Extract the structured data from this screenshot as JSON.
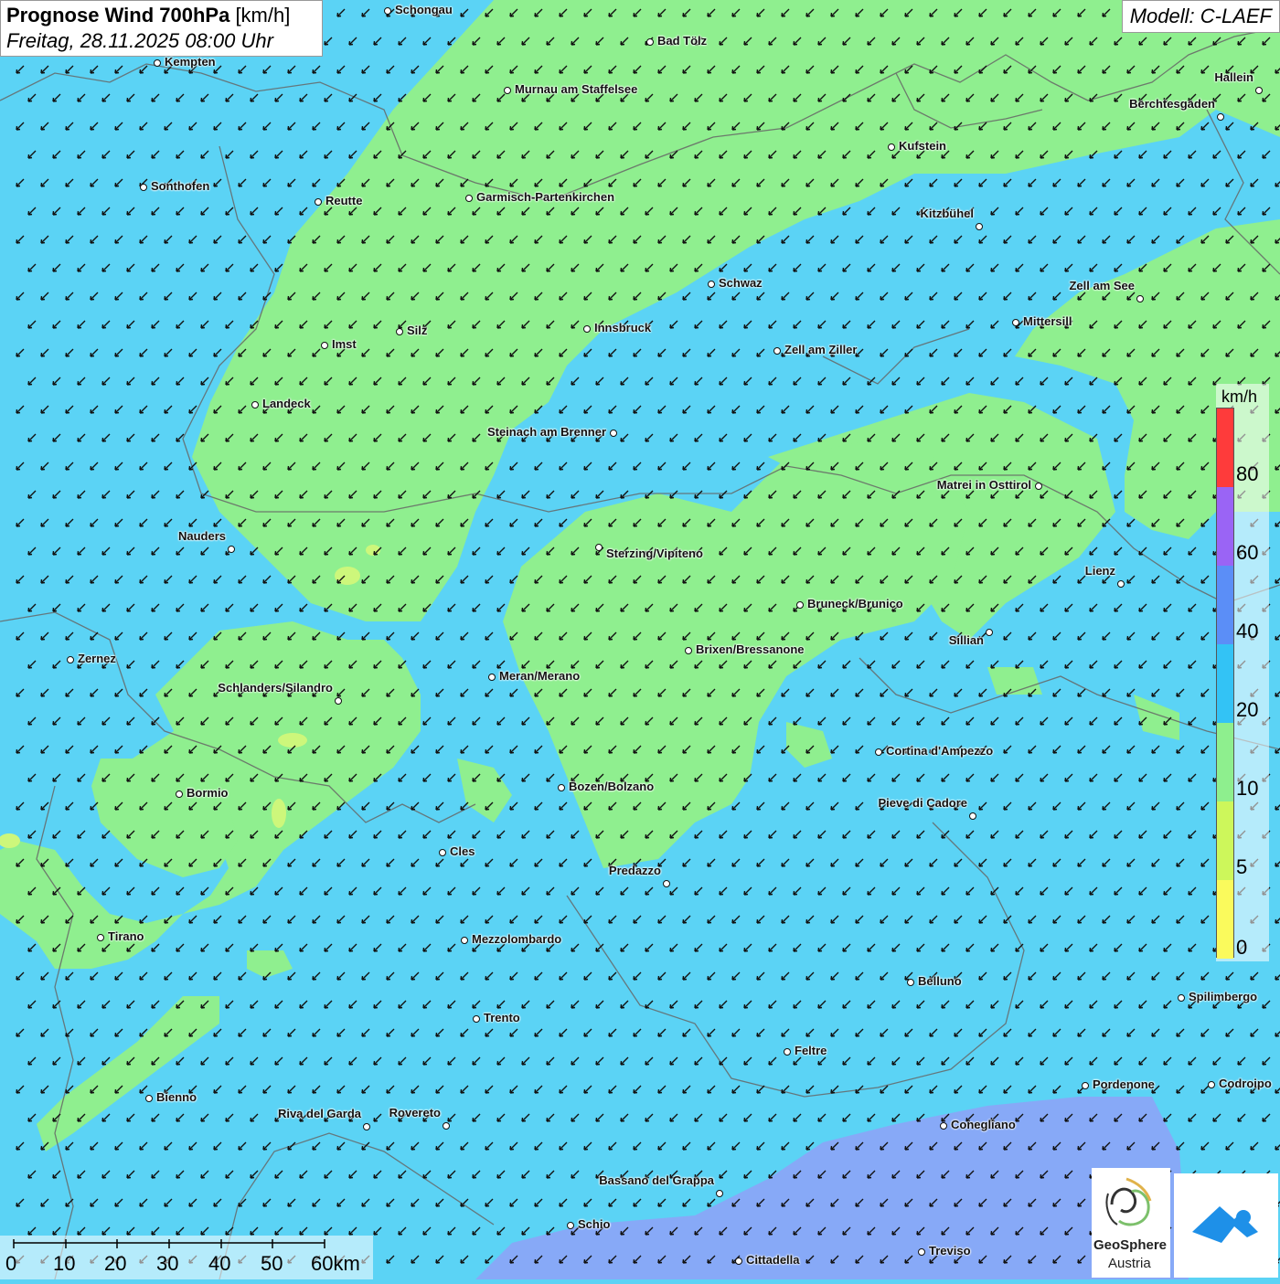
{
  "title": {
    "bold": "Prognose Wind 700hPa",
    "unit": "[km/h]",
    "date": "Freitag, 28.11.2025 08:00 Uhr"
  },
  "model": "Modell: C-LAEF",
  "legend": {
    "unit": "km/h",
    "labels": [
      "80",
      "60",
      "40",
      "20",
      "10",
      "5",
      "0"
    ],
    "colors": [
      "#fe3b3b",
      "#9a64f5",
      "#5b8ef7",
      "#33c3f5",
      "#8eef8e",
      "#cdf75b",
      "#fafa5c"
    ]
  },
  "scale": {
    "labels": [
      "0",
      "10",
      "20",
      "30",
      "40",
      "50",
      "60km"
    ]
  },
  "logos": {
    "geosphere_line1": "GeoSphere",
    "geosphere_line2": "Austria"
  },
  "colors": {
    "wind_10_20": "#8fef8f",
    "wind_20_40": "#5bd3f5",
    "wind_40_60": "#7f9ff6"
  },
  "cities": [
    {
      "name": "Schongau"
    },
    {
      "name": "Bad Tölz"
    },
    {
      "name": "Kempten"
    },
    {
      "name": "Murnau am Staffelsee"
    },
    {
      "name": "Hallein"
    },
    {
      "name": "Berchtesgaden"
    },
    {
      "name": "Kufstein"
    },
    {
      "name": "Sonthofen"
    },
    {
      "name": "Reutte"
    },
    {
      "name": "Garmisch-Partenkirchen"
    },
    {
      "name": "Kitzbühel"
    },
    {
      "name": "Schwaz"
    },
    {
      "name": "Zell am See"
    },
    {
      "name": "Mittersill"
    },
    {
      "name": "Innsbruck"
    },
    {
      "name": "Silz"
    },
    {
      "name": "Imst"
    },
    {
      "name": "Zell am Ziller"
    },
    {
      "name": "Landeck"
    },
    {
      "name": "Steinach am Brenner"
    },
    {
      "name": "Matrei in Osttirol"
    },
    {
      "name": "Nauders"
    },
    {
      "name": "Sterzing/Vipiteno"
    },
    {
      "name": "Lienz"
    },
    {
      "name": "Bruneck/Brunico"
    },
    {
      "name": "Sillian"
    },
    {
      "name": "Brixen/Bressanone"
    },
    {
      "name": "Zernez"
    },
    {
      "name": "Meran/Merano"
    },
    {
      "name": "Schlanders/Silandro"
    },
    {
      "name": "Cortina d'Ampezzo"
    },
    {
      "name": "Bozen/Bolzano"
    },
    {
      "name": "Bormio"
    },
    {
      "name": "Pieve di Cadore"
    },
    {
      "name": "Cles"
    },
    {
      "name": "Predazzo"
    },
    {
      "name": "Tirano"
    },
    {
      "name": "Mezzolombardo"
    },
    {
      "name": "Belluno"
    },
    {
      "name": "Spilimbergo"
    },
    {
      "name": "Trento"
    },
    {
      "name": "Feltre"
    },
    {
      "name": "Pordenone"
    },
    {
      "name": "Codroipo"
    },
    {
      "name": "Bienno"
    },
    {
      "name": "Riva del Garda"
    },
    {
      "name": "Rovereto"
    },
    {
      "name": "Conegliano"
    },
    {
      "name": "Bassano del Grappa"
    },
    {
      "name": "Schio"
    },
    {
      "name": "Treviso"
    },
    {
      "name": "Cittadella"
    }
  ]
}
